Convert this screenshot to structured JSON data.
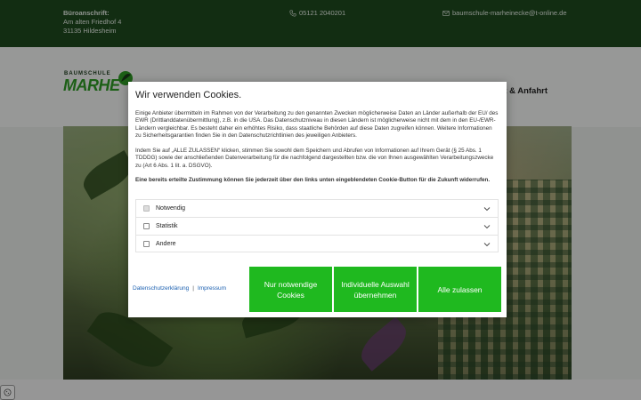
{
  "topbar": {
    "address_label": "Büroanschrift:",
    "address_line1": "Am alten Friedhof 4",
    "address_line2": "31135 Hildesheim",
    "phone": "05121 2040201",
    "email": "baumschule-marheinecke@t-online.de"
  },
  "header": {
    "logo_small": "BAUMSCHULE",
    "logo_big": "MARHE",
    "nav_partial": "kt & Anfahrt"
  },
  "colors": {
    "topbar": "#1d4a1d",
    "button": "#1fb91f",
    "link": "#1a5fb0"
  },
  "cookie": {
    "title": "Wir verwenden Cookies.",
    "para1": "Einige Anbieter übermitteln im Rahmen von der Verarbeitung zu den genannten Zwecken möglicherweise Daten an Länder außerhalb der EU/ des EWR (Drittlanddatenübermittlung), z.B. in die USA. Das Datenschutzniveau in diesen Ländern ist möglicherweise nicht mit dem in den EU-/EWR-Ländern vergleichbar. Es besteht daher ein erhöhtes Risiko, dass staatliche Behörden auf diese Daten zugreifen können. Weitere Informationen zu Sicherheitsgarantien finden Sie in den Datenschutzrichtlinien des jeweiligen Anbieters.",
    "para2": "Indem Sie auf „ALLE ZULASSEN“ klicken, stimmen Sie sowohl dem Speichern und Abrufen von Informationen auf Ihrem Gerät (§ 25 Abs. 1 TDDDG) sowie der anschließenden Datenverarbeitung für die nachfolgend dargestellten bzw. die von Ihnen ausgewählten Verarbeitungszwecke zu (Art 6 Abs. 1 lit. a. DSGVO).",
    "para3": "Eine bereits erteilte Zustimmung können Sie jederzeit über den links unten eingeblendeten Cookie-Button für die Zukunft widerrufen.",
    "options": [
      {
        "label": "Notwendig"
      },
      {
        "label": "Statistik"
      },
      {
        "label": "Andere"
      }
    ],
    "link_privacy": "Datenschutzerklärung",
    "link_sep": "|",
    "link_imprint": "Impressum",
    "btn_necessary": "Nur notwendige Cookies",
    "btn_individual": "Individuelle Auswahl übernehmen",
    "btn_all": "Alle zulassen"
  }
}
